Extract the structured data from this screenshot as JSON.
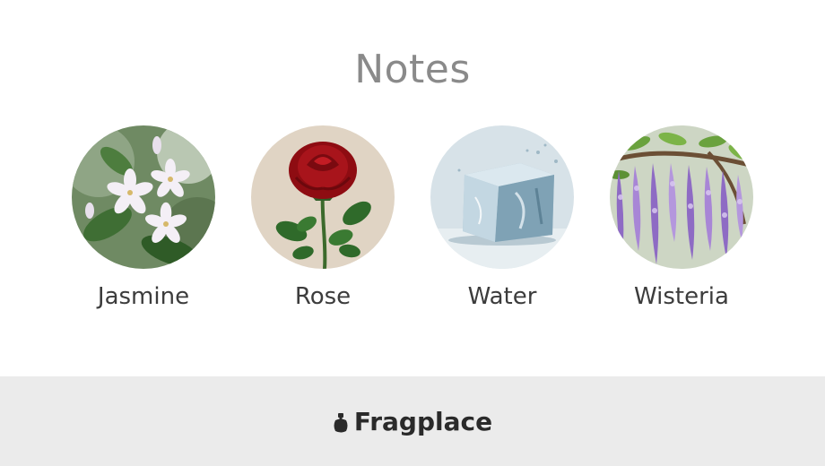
{
  "notes_section": {
    "title": "Notes",
    "notes": [
      {
        "label": "Jasmine",
        "icon": "jasmine-flower-image"
      },
      {
        "label": "Rose",
        "icon": "rose-flower-image"
      },
      {
        "label": "Water",
        "icon": "water-splash-image"
      },
      {
        "label": "Wisteria",
        "icon": "wisteria-flower-image"
      }
    ]
  },
  "footer": {
    "brand_name": "Fragplace",
    "brand_icon": "perfume-bottle-icon"
  }
}
